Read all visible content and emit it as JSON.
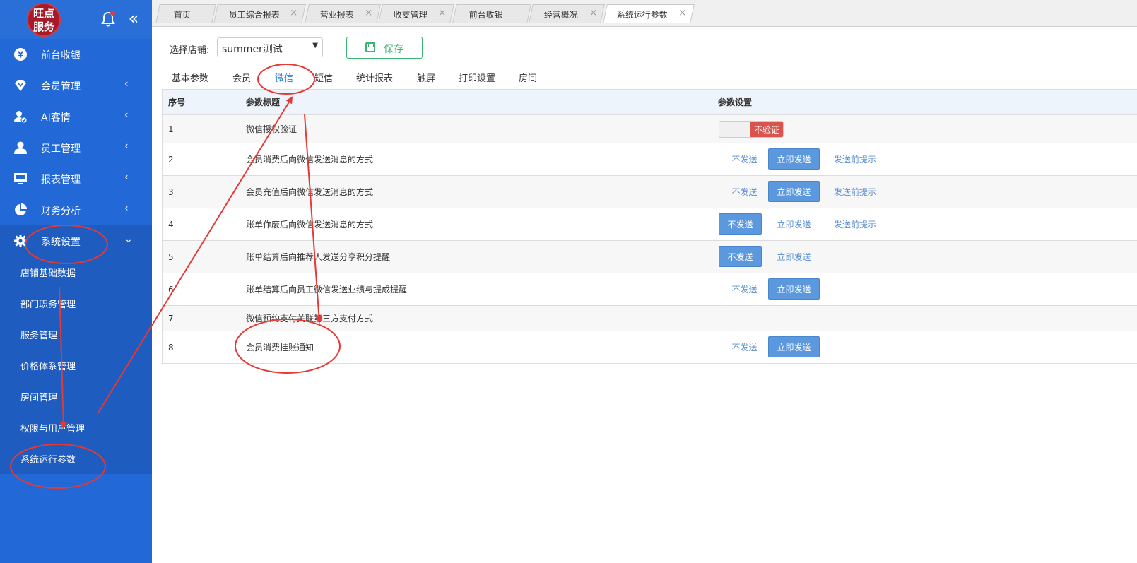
{
  "sidebar": {
    "logo_line1": "旺点",
    "logo_line2": "服务",
    "items": [
      {
        "label": "前台收银",
        "icon": "yen-icon",
        "arrow": ""
      },
      {
        "label": "会员管理",
        "icon": "diamond-icon",
        "arrow": "‹"
      },
      {
        "label": "AI客情",
        "icon": "user-check-icon",
        "arrow": "‹"
      },
      {
        "label": "员工管理",
        "icon": "person-icon",
        "arrow": "‹"
      },
      {
        "label": "报表管理",
        "icon": "monitor-icon",
        "arrow": "‹"
      },
      {
        "label": "财务分析",
        "icon": "pie-chart-icon",
        "arrow": "‹"
      },
      {
        "label": "系统设置",
        "icon": "gear-icon",
        "arrow": "⌄"
      }
    ],
    "submenu": [
      "店铺基础数据",
      "部门职务管理",
      "服务管理",
      "价格体系管理",
      "房间管理",
      "权限与用户管理",
      "系统运行参数"
    ]
  },
  "tabs": [
    {
      "label": "首页"
    },
    {
      "label": "员工综合报表"
    },
    {
      "label": "营业报表"
    },
    {
      "label": "收支管理"
    },
    {
      "label": "前台收银"
    },
    {
      "label": "经营概况"
    },
    {
      "label": "系统运行参数"
    }
  ],
  "tab_close": "×",
  "toolbar": {
    "store_label": "选择店铺:",
    "store_value": "summer测试",
    "save_label": "保存"
  },
  "subtabs": [
    "基本参数",
    "会员",
    "微信",
    "短信",
    "统计报表",
    "触屏",
    "打印设置",
    "房间"
  ],
  "table": {
    "headers": [
      "序号",
      "参数标题",
      "参数设置"
    ],
    "rows": [
      {
        "no": "1",
        "title": "微信授权验证",
        "toggle": "不验证"
      },
      {
        "no": "2",
        "title": "会员消费后向微信发送消息的方式",
        "opts": [
          "不发送",
          "立即发送",
          "发送前提示"
        ]
      },
      {
        "no": "3",
        "title": "会员充值后向微信发送消息的方式",
        "opts": [
          "不发送",
          "立即发送",
          "发送前提示"
        ]
      },
      {
        "no": "4",
        "title": "账单作废后向微信发送消息的方式",
        "opts": [
          "不发送",
          "立即发送",
          "发送前提示"
        ]
      },
      {
        "no": "5",
        "title": "账单结算后向推荐人发送分享积分提醒",
        "opts": [
          "不发送",
          "立即发送"
        ]
      },
      {
        "no": "6",
        "title": "账单结算后向员工微信发送业绩与提成提醒",
        "opts": [
          "不发送",
          "立即发送"
        ]
      },
      {
        "no": "7",
        "title": "微信预约支付关联第三方支付方式"
      },
      {
        "no": "8",
        "title": "会员消费挂账通知",
        "opts": [
          "不发送",
          "立即发送"
        ]
      }
    ]
  },
  "colors": {
    "sidebar": "#2268d6",
    "primary_btn": "#5b98dd",
    "save": "#3cb371",
    "toggle_off": "#d9534f",
    "annotation": "#e53935"
  }
}
